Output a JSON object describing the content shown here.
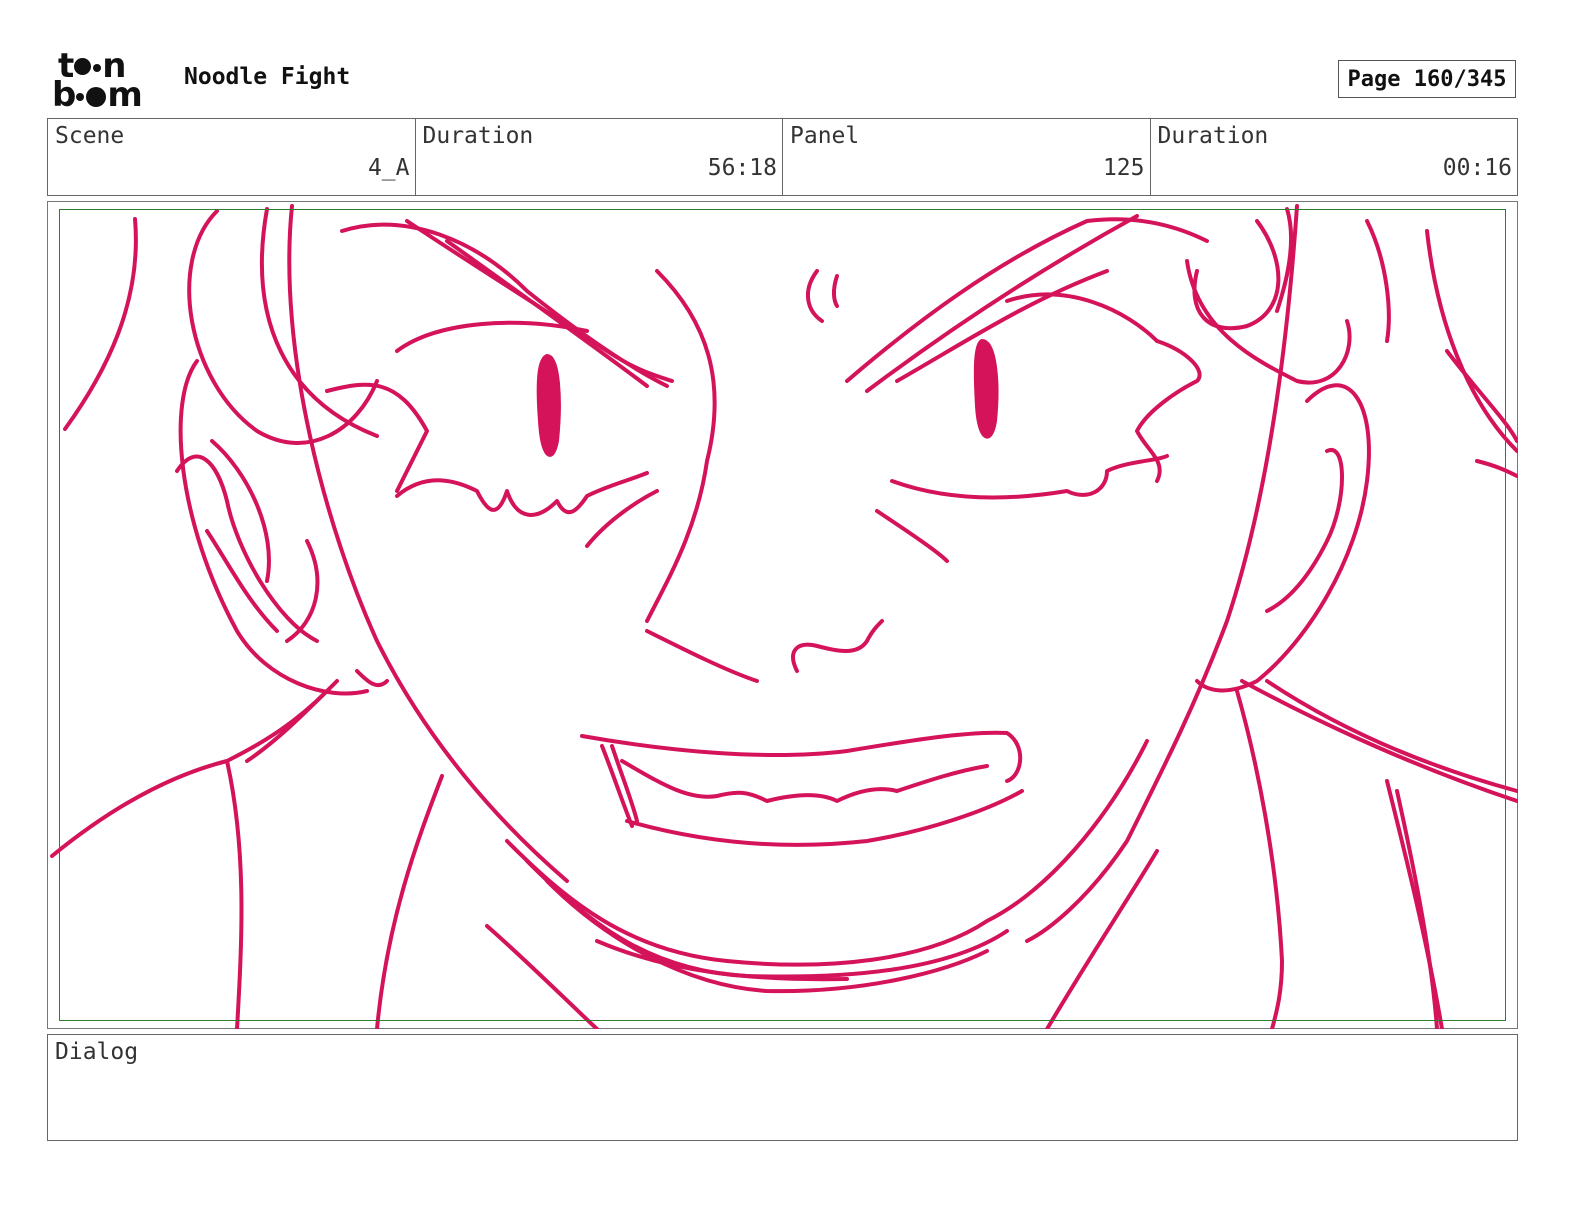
{
  "header": {
    "logo_top": "t",
    "logo_top_end": "n",
    "logo_bottom_start": "b",
    "logo_bottom_end": "m",
    "project_title": "Noodle Fight",
    "page_label": "Page 160/345"
  },
  "info": {
    "scene_label": "Scene",
    "scene_value": "4_A",
    "duration_label": "Duration",
    "duration_value": "56:18",
    "panel_label": "Panel",
    "panel_value": "125",
    "panel_duration_label": "Duration",
    "panel_duration_value": "00:16"
  },
  "dialog": {
    "label": "Dialog"
  },
  "colors": {
    "sketch_stroke": "#d4135a",
    "safe_frame": "#2e7d32"
  }
}
